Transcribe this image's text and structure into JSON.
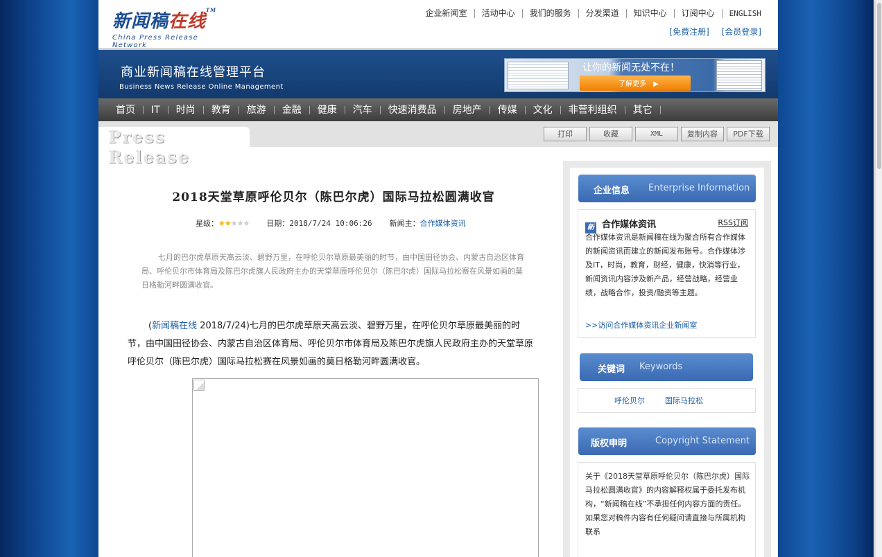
{
  "header": {
    "logo_cn_a": "新闻稿",
    "logo_cn_b": "在线",
    "logo_tm": "TM",
    "logo_en": "China Press Release Network",
    "topnav": [
      "企业新闻室",
      "活动中心",
      "我们的服务",
      "分发渠道",
      "知识中心",
      "订阅中心",
      "ENGLISH"
    ],
    "register": "[免费注册]",
    "login": "[会员登录]"
  },
  "banner": {
    "title": "商业新闻稿在线管理平台",
    "subtitle": "Business News Release Online Management",
    "promo_slogan": "让你的新闻无处不在！",
    "promo_button": "了解更多"
  },
  "categories": [
    "首页",
    "IT",
    "时尚",
    "教育",
    "旅游",
    "金融",
    "健康",
    "汽车",
    "快速消费品",
    "房地产",
    "传媒",
    "文化",
    "非营利组织",
    "其它"
  ],
  "prbar": {
    "tab_label": "Press Release",
    "tools": [
      "打印",
      "收藏",
      "XML",
      "复制内容",
      "PDF下载"
    ]
  },
  "article": {
    "title": "2018天堂草原呼伦贝尔（陈巴尔虎）国际马拉松圆满收官",
    "rating_label": "星级：",
    "rating": 2,
    "rating_max": 5,
    "date_label": "日期：",
    "date": "2018/7/24 10:06:26",
    "publisher_label": "新闻主：",
    "publisher": "合作媒体资讯",
    "summary": "七月的巴尔虎草原天高云淡、碧野万里，在呼伦贝尔草原最美丽的时节，由中国田径协会、内蒙古自治区体育局、呼伦贝尔市体育局及陈巴尔虎旗人民政府主办的天堂草原呼伦贝尔（陈巴尔虎）国际马拉松赛在风景如画的莫日格勒河畔圆满收官。",
    "body_open": "(",
    "body_source": "新闻稿在线",
    "body_text": " 2018/7/24)七月的巴尔虎草原天高云淡、碧野万里，在呼伦贝尔草原最美丽的时节，由中国田径协会、内蒙古自治区体育局、呼伦贝尔市体育局及陈巴尔虎旗人民政府主办的天堂草原呼伦贝尔（陈巴尔虎）国际马拉松赛在风景如画的莫日格勒河畔圆满收官。"
  },
  "sidebar": {
    "company": {
      "header_cn": "企业信息",
      "header_en": "Enterprise Information",
      "name": "合作媒体资讯",
      "icon_text": "新",
      "rss": "RSS订阅",
      "desc": "合作媒体资讯是新闻稿在线为聚合所有合作媒体的新闻资讯而建立的新闻发布账号。合作媒体涉及IT，时尚，教育，财经，健康，快消等行业，新闻资讯内容涉及新产品，经营战略，经营业绩，战略合作，投资/融资等主题。",
      "link": ">>访问合作媒体资讯企业新闻室"
    },
    "keywords": {
      "header_cn": "关键词",
      "header_en": "Keywords",
      "items": [
        "呼伦贝尔",
        "国际马拉松"
      ]
    },
    "copyright": {
      "header_cn": "版权申明",
      "header_en": "Copyright Statement",
      "text": "关于《2018天堂草原呼伦贝尔（陈巴尔虎）国际马拉松圆满收官》的内容解释权属于委托发布机构，“新闻稿在线”不承担任何内容方面的责任。",
      "text2": "如果您对稿件内容有任何疑问请直接与所属机构联系"
    }
  }
}
